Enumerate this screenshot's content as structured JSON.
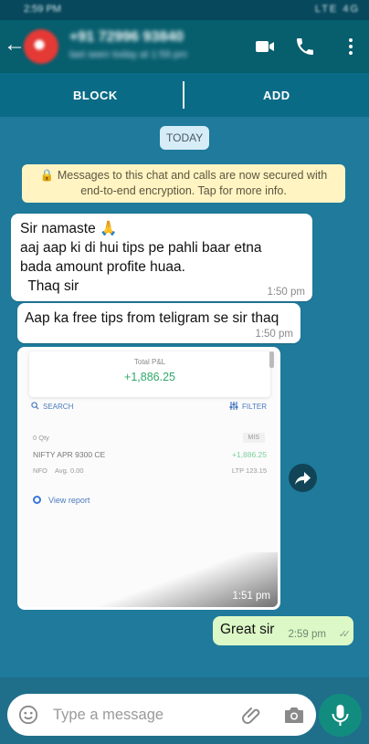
{
  "status_bar": {
    "time": "2:59 PM",
    "icons": "LTE 4G"
  },
  "header": {
    "back_glyph": "←",
    "contact_name": "+91 72996 93840",
    "contact_status": "last seen today at 1:59 pm",
    "icons": [
      "video-call-icon",
      "phone-icon",
      "more-vert-icon"
    ]
  },
  "action_bar": {
    "block_label": "BLOCK",
    "add_label": "ADD"
  },
  "chat": {
    "date_chip": "TODAY",
    "encryption_notice": "🔒 Messages to this chat and calls are now secured with end-to-end encryption. Tap for more info.",
    "messages": [
      {
        "direction": "incoming",
        "lines": [
          "Sir namaste 🙏",
          "aaj aap ki di hui tips pe pahli baar etna",
          "bada amount profite huaa.",
          "  Thaq sir"
        ],
        "time": "1:50 pm"
      },
      {
        "direction": "incoming",
        "text": "Aap ka free tips from teligram se sir thaq",
        "time": "1:50 pm"
      },
      {
        "direction": "incoming",
        "type": "image",
        "time": "1:51 pm",
        "image": {
          "total_label": "Total P&L",
          "total_value": "+1,886.25",
          "search_label": "SEARCH",
          "filter_label": "FILTER",
          "qty": "0 Qty",
          "product": "MIS",
          "symbol": "NIFTY APR 9300 CE",
          "pnl": "+1,886.25",
          "exchange": "NFO",
          "avg": "Avg. 0.00",
          "ltp": "LTP 123.15",
          "view_report": "View report"
        }
      },
      {
        "direction": "outgoing",
        "text": "Great sir",
        "time": "2:59 pm",
        "ticks": "✓✓"
      }
    ]
  },
  "composer": {
    "placeholder": "Type a message",
    "icons": [
      "emoji-icon",
      "attach-icon",
      "camera-icon",
      "mic-icon"
    ]
  },
  "colors": {
    "header": "#075e6d",
    "chat_bg": "#1f7a9b",
    "outgoing_bubble": "#dcf8c6",
    "mic_button": "#128c7e",
    "profit_green": "#2fa869"
  }
}
